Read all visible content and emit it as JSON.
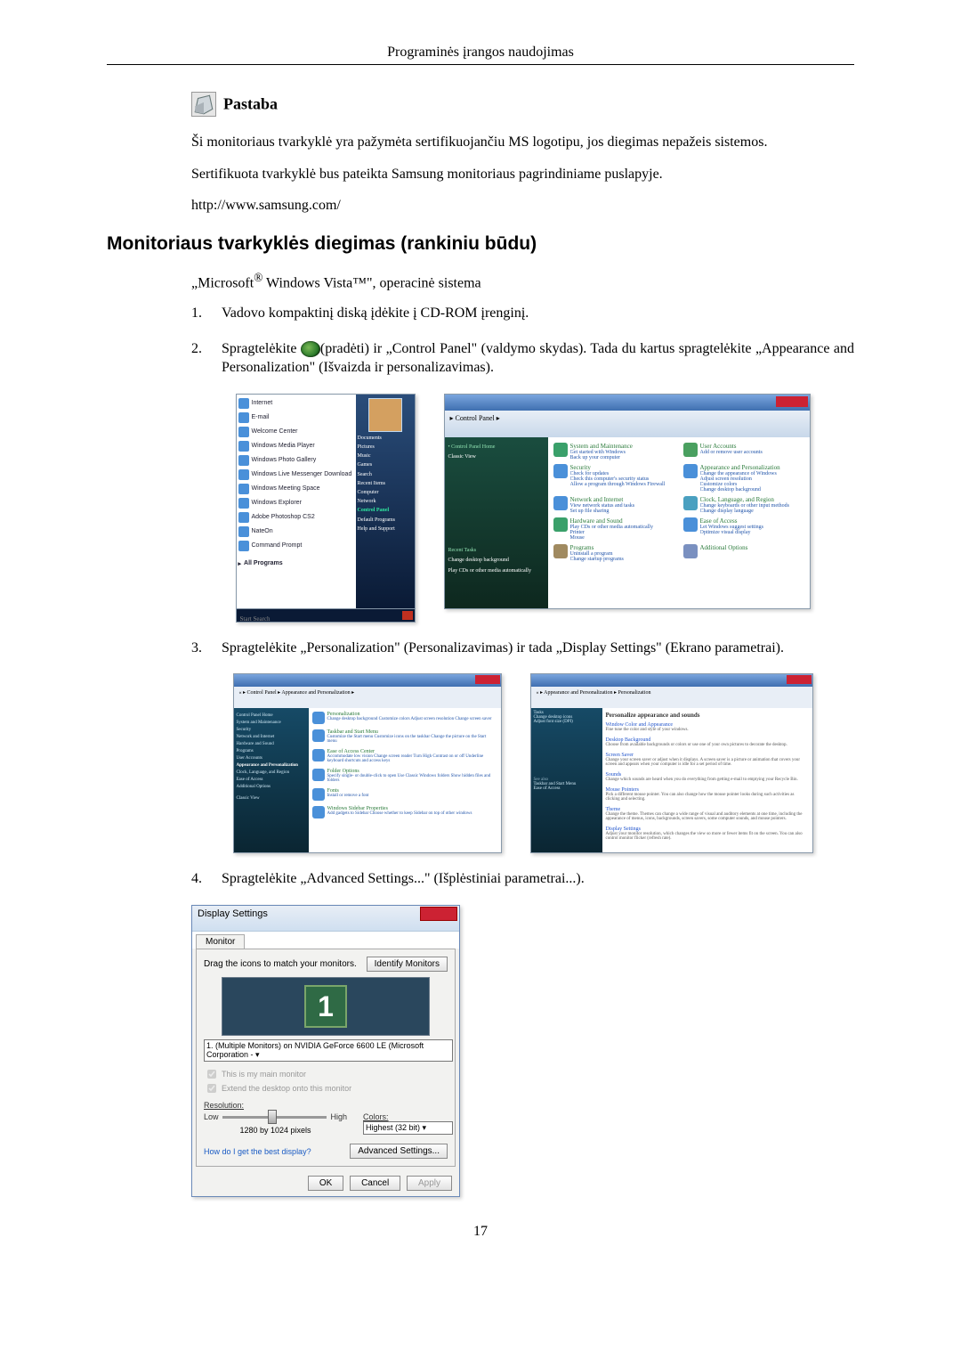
{
  "header": "Programinės įrangos naudojimas",
  "note": {
    "title": "Pastaba",
    "p1": "Ši monitoriaus tvarkyklė yra pažymėta sertifikuojančiu MS logotipu, jos diegimas nepažeis sistemos.",
    "p2": "Sertifikuota tvarkyklė bus pateikta Samsung monitoriaus pagrindiniame puslapyje.",
    "url": "http://www.samsung.com/"
  },
  "section_title": "Monitoriaus tvarkyklės diegimas (rankiniu būdu)",
  "os_line_prefix": "„Microsoft",
  "os_line_mid": " Windows Vista™\", operacinė sistema",
  "steps": {
    "s1": {
      "num": "1.",
      "text": "Vadovo kompaktinį diską įdėkite į CD-ROM įrenginį."
    },
    "s2": {
      "num": "2.",
      "pre": "Spragtelėkite ",
      "post": "(pradėti) ir „Control Panel\" (valdymo skydas). Tada du kartus spragtelėkite „Appearance and Personalization\" (Išvaizda ir personalizavimas)."
    },
    "s3": {
      "num": "3.",
      "text": "Spragtelėkite „Personalization\" (Personalizavimas) ir tada „Display Settings\" (Ekrano parametrai)."
    },
    "s4": {
      "num": "4.",
      "text": "Spragtelėkite „Advanced Settings...\" (Išplėstiniai parametrai...)."
    }
  },
  "start_menu": {
    "items": [
      "Internet",
      "E-mail",
      "Welcome Center",
      "Windows Media Player",
      "Windows Photo Gallery",
      "Windows Live Messenger Download",
      "Windows Meeting Space",
      "Windows Explorer",
      "Adobe Photoshop CS2",
      "NateOn",
      "Command Prompt"
    ],
    "all": "All Programs",
    "right": [
      "Documents",
      "Pictures",
      "Music",
      "Games",
      "Search",
      "Recent Items",
      "Computer",
      "Network"
    ],
    "control_panel": "Control Panel",
    "right2": [
      "Default Programs",
      "Help and Support"
    ],
    "search": "Start Search"
  },
  "control_panel": {
    "addr": "  ▸ Control Panel ▸",
    "side_head": "Control Panel Home",
    "side_item": "Classic View",
    "recent": "Recent Tasks",
    "recent_items": [
      "Change desktop background",
      "Play CDs or other media automatically"
    ],
    "cats": [
      {
        "h": "System and Maintenance",
        "lines": [
          "Get started with Windows",
          "Back up your computer"
        ],
        "c": "#3aa06a"
      },
      {
        "h": "User Accounts",
        "lines": [
          "Add or remove user accounts"
        ],
        "c": "#4aa060"
      },
      {
        "h": "Security",
        "lines": [
          "Check for updates",
          "Check this computer's security status",
          "Allow a program through Windows Firewall"
        ],
        "c": "#4a90d9"
      },
      {
        "h": "Appearance and Personalization",
        "lines": [
          "Change the appearance of Windows",
          "Adjust screen resolution",
          "Customize colors",
          "Change desktop background"
        ],
        "c": "#4a90d9"
      },
      {
        "h": "Network and Internet",
        "lines": [
          "View network status and tasks",
          "Set up file sharing"
        ],
        "c": "#4a90d9"
      },
      {
        "h": "Clock, Language, and Region",
        "lines": [
          "Change keyboards or other input methods",
          "Change display language"
        ],
        "c": "#4aa0c0"
      },
      {
        "h": "Hardware and Sound",
        "lines": [
          "Play CDs or other media automatically",
          "Printer",
          "Mouse"
        ],
        "c": "#3aa06a"
      },
      {
        "h": "Ease of Access",
        "lines": [
          "Let Windows suggest settings",
          "Optimize visual display"
        ],
        "c": "#4a90d9"
      },
      {
        "h": "Programs",
        "lines": [
          "Uninstall a program",
          "Change startup programs"
        ],
        "c": "#a08a60"
      },
      {
        "h": "Additional Options",
        "lines": [],
        "c": "#7a90c0"
      }
    ]
  },
  "appearance": {
    "addr": "« ▸ Control Panel ▸ Appearance and Personalization ▸",
    "side": [
      "Control Panel Home",
      "System and Maintenance",
      "Security",
      "Network and Internet",
      "Hardware and Sound",
      "Programs",
      "User Accounts",
      "Appearance and Personalization",
      "Clock, Language, and Region",
      "Ease of Access",
      "Additional Options"
    ],
    "classic": "Classic View",
    "sects": [
      {
        "h": "Personalization",
        "ln": "Change desktop background  Customize colors  Adjust screen resolution  Change screen saver"
      },
      {
        "h": "Taskbar and Start Menu",
        "ln": "Customize the Start menu  Customize icons on the taskbar  Change the picture on the Start menu"
      },
      {
        "h": "Ease of Access Center",
        "ln": "Accommodate low vision  Change screen reader  Turn High Contrast on or off  Underline keyboard shortcuts and access keys"
      },
      {
        "h": "Folder Options",
        "ln": "Specify single- or double-click to open  Use Classic Windows folders  Show hidden files and folders"
      },
      {
        "h": "Fonts",
        "ln": "Install or remove a font"
      },
      {
        "h": "Windows Sidebar Properties",
        "ln": "Add gadgets to Sidebar  Choose whether to keep Sidebar on top of other windows"
      }
    ]
  },
  "personalization": {
    "addr": "« ▸ Appearance and Personalization ▸ Personalization",
    "side": [
      "Tasks",
      "Change desktop icons",
      "Adjust font size (DPI)"
    ],
    "title": "Personalize appearance and sounds",
    "items": [
      {
        "t": "Window Color and Appearance",
        "d": "Fine tune the color and style of your windows."
      },
      {
        "t": "Desktop Background",
        "d": "Choose from available backgrounds or colors or use one of your own pictures to decorate the desktop."
      },
      {
        "t": "Screen Saver",
        "d": "Change your screen saver or adjust when it displays. A screen saver is a picture or animation that covers your screen and appears when your computer is idle for a set period of time."
      },
      {
        "t": "Sounds",
        "d": "Change which sounds are heard when you do everything from getting e-mail to emptying your Recycle Bin."
      },
      {
        "t": "Mouse Pointers",
        "d": "Pick a different mouse pointer. You can also change how the mouse pointer looks during such activities as clicking and selecting."
      },
      {
        "t": "Theme",
        "d": "Change the theme. Themes can change a wide range of visual and auditory elements at one time, including the appearance of menus, icons, backgrounds, screen savers, some computer sounds, and mouse pointers."
      },
      {
        "t": "Display Settings",
        "d": "Adjust your monitor resolution, which changes the view so more or fewer items fit on the screen. You can also control monitor flicker (refresh rate)."
      }
    ],
    "seealso": "See also",
    "seeitems": [
      "Taskbar and Start Menu",
      "Ease of Access"
    ]
  },
  "display_settings": {
    "title": "Display Settings",
    "tab": "Monitor",
    "drag": "Drag the icons to match your monitors.",
    "identify": "Identify Monitors",
    "monitor_num": "1",
    "select": "1. (Multiple Monitors) on NVIDIA GeForce 6600 LE (Microsoft Corporation - ▾",
    "chk1": "This is my main monitor",
    "chk2": "Extend the desktop onto this monitor",
    "resolution_lbl": "Resolution:",
    "low": "Low",
    "high": "High",
    "res_val": "1280 by 1024 pixels",
    "colors_lbl": "Colors:",
    "colors_val": "Highest (32 bit)      ▾",
    "help": "How do I get the best display?",
    "adv": "Advanced Settings...",
    "ok": "OK",
    "cancel": "Cancel",
    "apply": "Apply"
  },
  "page_num": "17"
}
